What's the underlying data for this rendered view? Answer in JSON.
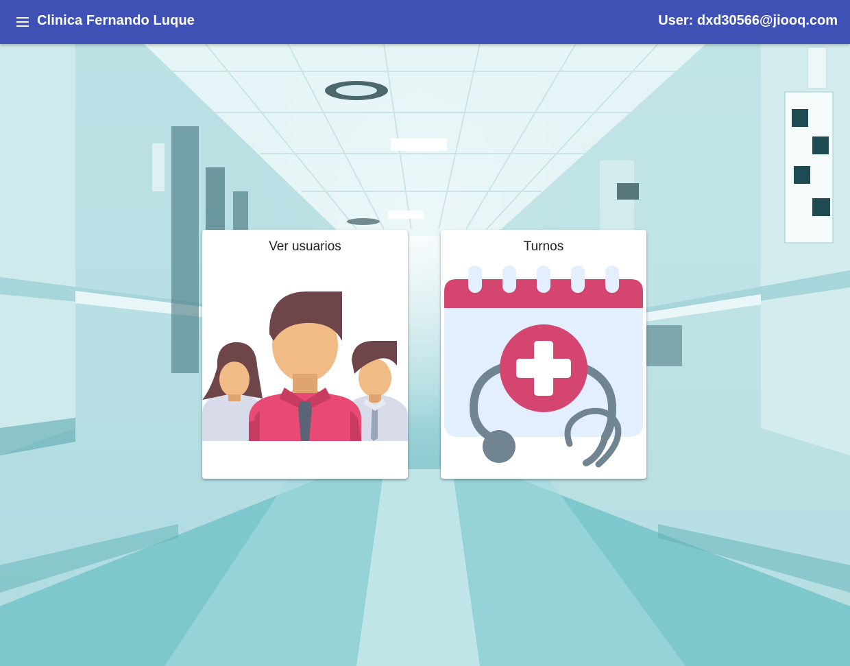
{
  "toolbar": {
    "title": "Clinica Fernando Luque",
    "user_label": "User: dxd30566@jiooq.com",
    "menu_icon": "menu-icon",
    "background_color": "#3f51b5"
  },
  "cards": [
    {
      "title": "Ver usuarios",
      "icon": "users-group-icon"
    },
    {
      "title": "Turnos",
      "icon": "medical-calendar-icon"
    }
  ],
  "colors": {
    "accent_pink": "#d4466f",
    "skin": "#f0bb84",
    "hair": "#6b4547",
    "calendar_bg": "#e3effd",
    "stethoscope": "#708492"
  }
}
